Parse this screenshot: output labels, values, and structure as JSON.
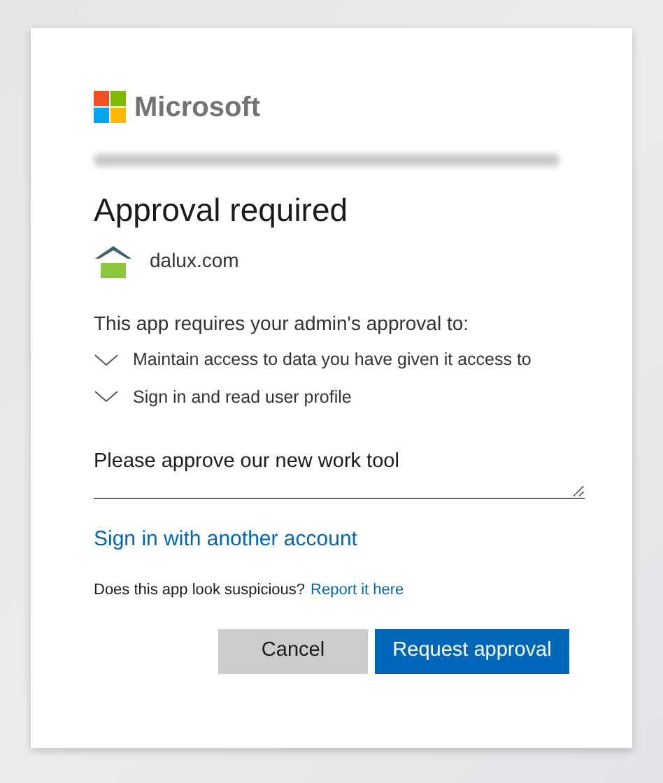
{
  "brand": {
    "name": "Microsoft"
  },
  "title": "Approval required",
  "app": {
    "domain": "dalux.com"
  },
  "intro": "This app requires your admin's approval to:",
  "permissions": [
    {
      "label": "Maintain access to data you have given it access to",
      "expanded": false
    },
    {
      "label": "Sign in and read user profile",
      "expanded": false
    }
  ],
  "justification": {
    "value": "Please approve our new work tool"
  },
  "switch_account_link": "Sign in with another account",
  "report": {
    "question": "Does this app look suspicious?",
    "link": "Report it here"
  },
  "buttons": [
    {
      "label": "Cancel",
      "kind": "secondary"
    },
    {
      "label": "Request approval",
      "kind": "primary"
    }
  ]
}
